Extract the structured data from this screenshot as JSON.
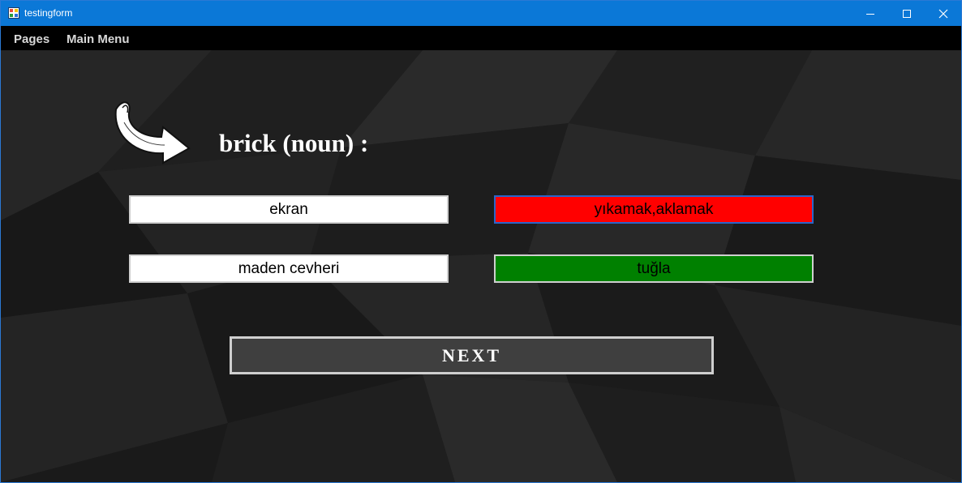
{
  "window": {
    "title": "testingform",
    "controls": {
      "minimize": "minimize-icon",
      "maximize": "maximize-icon",
      "close": "close-icon"
    }
  },
  "menu": {
    "items": [
      {
        "label": "Pages"
      },
      {
        "label": "Main Menu"
      }
    ]
  },
  "quiz": {
    "word": "brick (noun) :",
    "choices": [
      {
        "label": "ekran",
        "state": "neutral"
      },
      {
        "label": "yıkamak,aklamak",
        "state": "wrong"
      },
      {
        "label": "maden cevheri",
        "state": "neutral"
      },
      {
        "label": "tuğla",
        "state": "correct"
      }
    ],
    "next_label": "NEXT"
  },
  "colors": {
    "titlebar": "#0b78d7",
    "menubar": "#000000",
    "background": "#1c1c1c",
    "wrong": "#ff0000",
    "correct": "#008000",
    "next_button": "#3f3f3f"
  }
}
